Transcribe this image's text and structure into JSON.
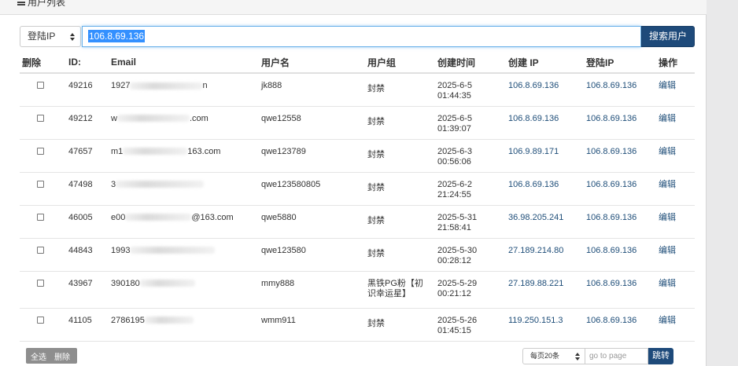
{
  "panel": {
    "title": "用户列表",
    "title_icon": "list-icon"
  },
  "search": {
    "field_selected": "登陆IP",
    "query": "106.8.69.136",
    "button_label": "搜索用户"
  },
  "table": {
    "headers": [
      "删除",
      "ID:",
      "Email",
      "用户名",
      "用户组",
      "创建时间",
      "创建 IP",
      "登陆IP",
      "操作"
    ],
    "rows": [
      {
        "id": "49216",
        "email_start": "1927",
        "email_end": "n",
        "username": "jk888",
        "group": "封禁",
        "date": "2025-6-5",
        "time": "01:44:35",
        "create_ip": "106.8.69.136",
        "login_ip": "106.8.69.136",
        "action": "编辑"
      },
      {
        "id": "49212",
        "email_start": "w",
        "email_end": ".com",
        "username": "qwe12558",
        "group": "封禁",
        "date": "2025-6-5",
        "time": "01:39:07",
        "create_ip": "106.8.69.136",
        "login_ip": "106.8.69.136",
        "action": "编辑"
      },
      {
        "id": "47657",
        "email_start": "m1",
        "email_end": "163.com",
        "username": "qwe123789",
        "group": "封禁",
        "date": "2025-6-3",
        "time": "00:56:06",
        "create_ip": "106.9.89.171",
        "login_ip": "106.8.69.136",
        "action": "编辑"
      },
      {
        "id": "47498",
        "email_start": "3",
        "email_end": "",
        "username": "qwe123580805",
        "group": "封禁",
        "date": "2025-6-2",
        "time": "21:24:55",
        "create_ip": "106.8.69.136",
        "login_ip": "106.8.69.136",
        "action": "编辑"
      },
      {
        "id": "46005",
        "email_start": "e00",
        "email_end": "@163.com",
        "username": "qwe5880",
        "group": "封禁",
        "date": "2025-5-31",
        "time": "21:58:41",
        "create_ip": "36.98.205.241",
        "login_ip": "106.8.69.136",
        "action": "编辑"
      },
      {
        "id": "44843",
        "email_start": "1993",
        "email_end": "",
        "username": "qwe123580",
        "group": "封禁",
        "date": "2025-5-30",
        "time": "00:28:12",
        "create_ip": "27.189.214.80",
        "login_ip": "106.8.69.136",
        "action": "编辑"
      },
      {
        "id": "43967",
        "email_start": "390180",
        "email_end": "",
        "username": "mmy888",
        "group": "黑铁PG粉【初识幸运星】",
        "date": "2025-5-29",
        "time": "00:21:12",
        "create_ip": "27.189.88.221",
        "login_ip": "106.8.69.136",
        "action": "编辑"
      },
      {
        "id": "41105",
        "email_start": "2786195",
        "email_end": "",
        "username": "wmm911",
        "group": "封禁",
        "date": "2025-5-26",
        "time": "01:45:15",
        "create_ip": "119.250.151.3",
        "login_ip": "106.8.69.136",
        "action": "编辑"
      }
    ]
  },
  "footer": {
    "select_all_label": "全选",
    "delete_label": "删除",
    "page_size_selected": "每页20条",
    "goto_placeholder": "go to page",
    "goto_button_label": "跳转"
  },
  "colors": {
    "primary": "#1e4a7a",
    "link": "#1f4e79",
    "selection": "#3390ff"
  }
}
